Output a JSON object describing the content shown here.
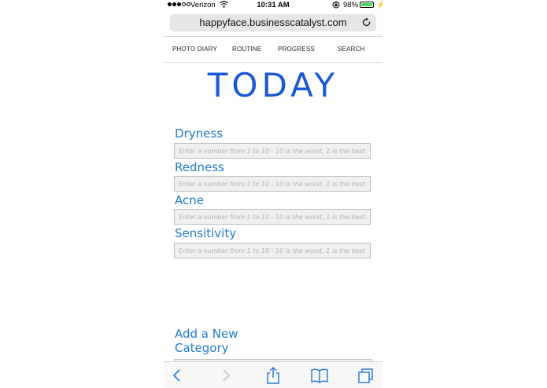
{
  "status_bar": {
    "carrier": "Verizon",
    "time": "10:31 AM",
    "battery": "98%"
  },
  "browser": {
    "url": "happyface.businesscatalyst.com"
  },
  "nav": {
    "items": [
      "PHOTO DIARY",
      "ROUTINE",
      "PROGRESS",
      "SEARCH"
    ]
  },
  "page": {
    "title": "TODAY",
    "categories": [
      {
        "label": "Dryness",
        "placeholder": "Enter a number from 1 to 10 - 10 is the worst, 1 is the best!"
      },
      {
        "label": "Redness",
        "placeholder": "Enter a number from 1 to 10 - 10 is the worst, 1 is the best!"
      },
      {
        "label": "Acne",
        "placeholder": "Enter a number from 1 to 10 - 10 is the worst, 1 is the best!"
      },
      {
        "label": "Sensitivity",
        "placeholder": "Enter a number from 1 to 10 - 10 is the worst, 1 is the best!"
      }
    ],
    "add_category": "Add a New Category"
  },
  "colors": {
    "title": "#1a58d6",
    "labels": "#1d7bcc",
    "toolbar_icons": "#2f7dd8"
  },
  "icons": [
    "wifi-icon",
    "lock-rotation-icon",
    "battery-icon",
    "reload-icon",
    "back-icon",
    "forward-icon",
    "share-icon",
    "bookmarks-icon",
    "tabs-icon"
  ]
}
